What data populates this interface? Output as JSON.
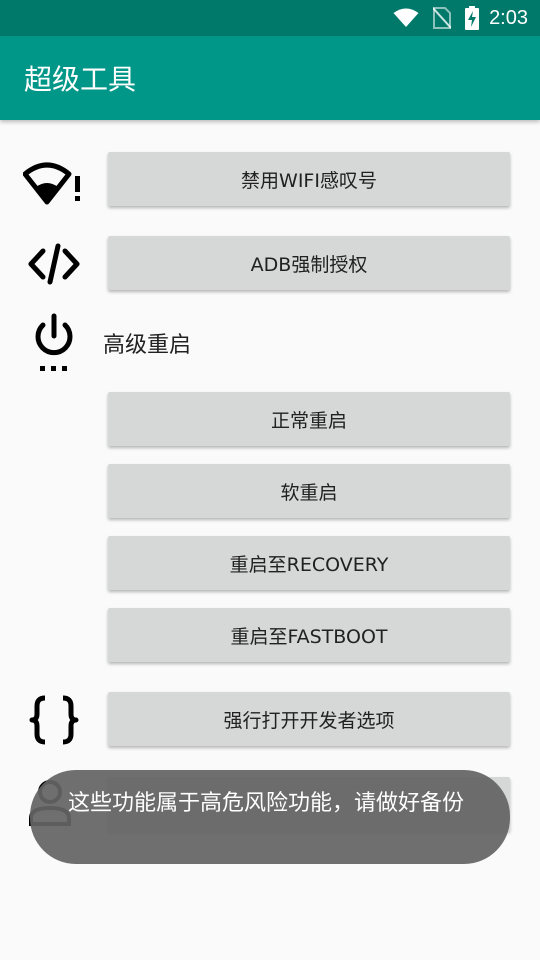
{
  "status_bar": {
    "time": "2:03",
    "icons": [
      "wifi-icon",
      "no-sim-icon",
      "battery-charging-icon"
    ]
  },
  "app_bar": {
    "title": "超级工具"
  },
  "items": {
    "disable_wifi": {
      "icon": "wifi-alert-icon",
      "label": "禁用WIFI感叹号"
    },
    "adb_auth": {
      "icon": "code-icon",
      "label": "ADB强制授权"
    },
    "advanced_reboot": {
      "icon": "power-settings-icon",
      "title": "高级重启",
      "buttons": {
        "normal": "正常重启",
        "soft": "软重启",
        "recovery": "重启至RECOVERY",
        "fastboot": "重启至FASTBOOT"
      }
    },
    "dev_options": {
      "icon": "braces-icon",
      "label": "强行打开开发者选项"
    },
    "hidden_row": {
      "icon": "person-icon"
    }
  },
  "toast": {
    "message": "这些功能属于高危风险功能，请做好备份"
  },
  "colors": {
    "status_bar": "#00796b",
    "app_bar": "#009688",
    "button": "#d6d7d7",
    "toast": "#646464"
  }
}
